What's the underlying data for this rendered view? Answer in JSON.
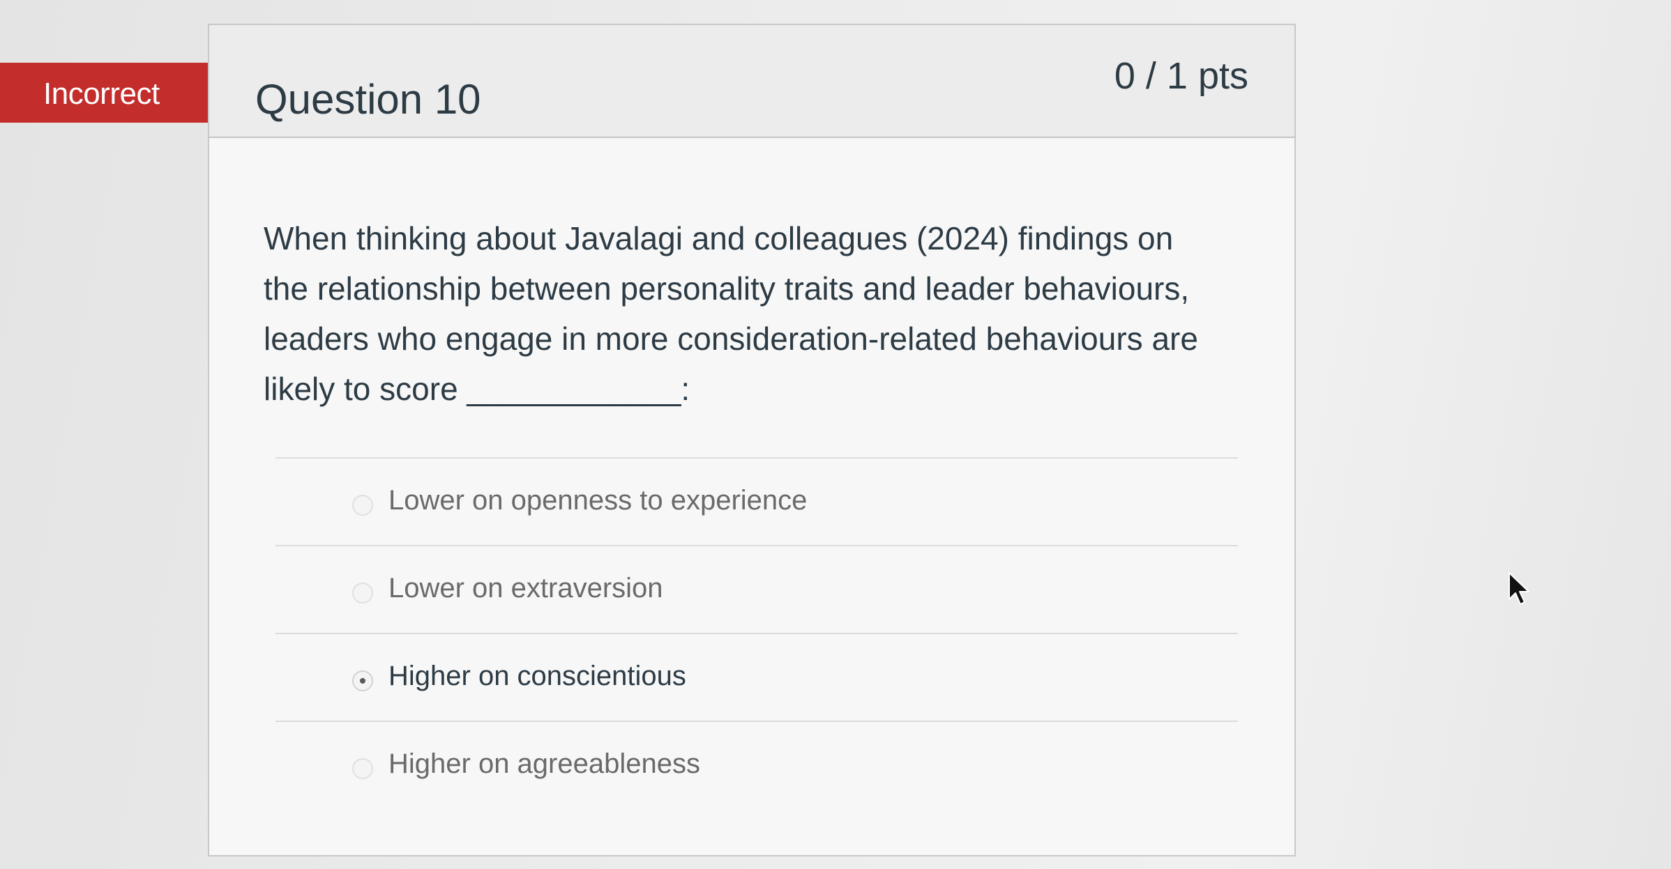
{
  "status": {
    "label": "Incorrect",
    "color": "#c32d2b"
  },
  "question": {
    "title": "Question 10",
    "points": "0 / 1 pts",
    "text": "When thinking about Javalagi and colleagues (2024) findings on the relationship between personality traits and leader behaviours, leaders who engage in more consideration-related behaviours are likely to score ____________:"
  },
  "answers": [
    {
      "label": "Lower on openness to experience",
      "selected": false
    },
    {
      "label": "Lower on extraversion",
      "selected": false
    },
    {
      "label": "Higher on conscientious",
      "selected": true
    },
    {
      "label": "Higher on agreeableness",
      "selected": false
    }
  ],
  "icons": {
    "cursor": "mouse-pointer-icon"
  }
}
